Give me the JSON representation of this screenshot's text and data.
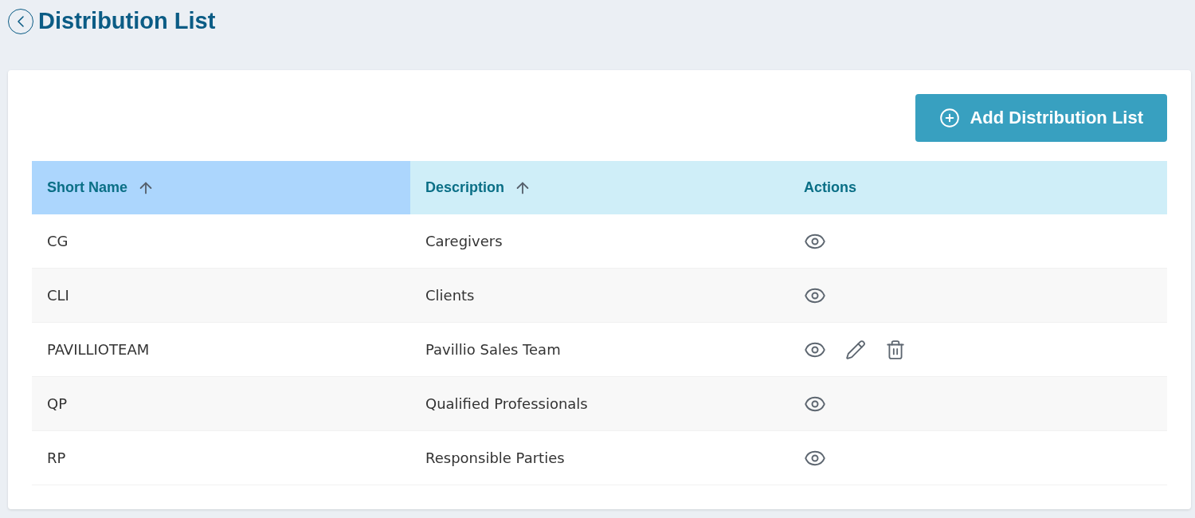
{
  "page": {
    "title": "Distribution List"
  },
  "add_button": {
    "label": "Add Distribution List"
  },
  "table": {
    "columns": [
      {
        "label": "Short Name",
        "sortable": true,
        "sorted": true
      },
      {
        "label": "Description",
        "sortable": true,
        "sorted": false
      },
      {
        "label": "Actions",
        "sortable": false,
        "sorted": false
      }
    ],
    "rows": [
      {
        "short_name": "CG",
        "description": "Caregivers",
        "editable": false
      },
      {
        "short_name": "CLI",
        "description": "Clients",
        "editable": false
      },
      {
        "short_name": "PAVILLIOTEAM",
        "description": "Pavillio Sales Team",
        "editable": true
      },
      {
        "short_name": "QP",
        "description": "Qualified Professionals",
        "editable": false
      },
      {
        "short_name": "RP",
        "description": "Responsible Parties",
        "editable": false
      }
    ]
  }
}
